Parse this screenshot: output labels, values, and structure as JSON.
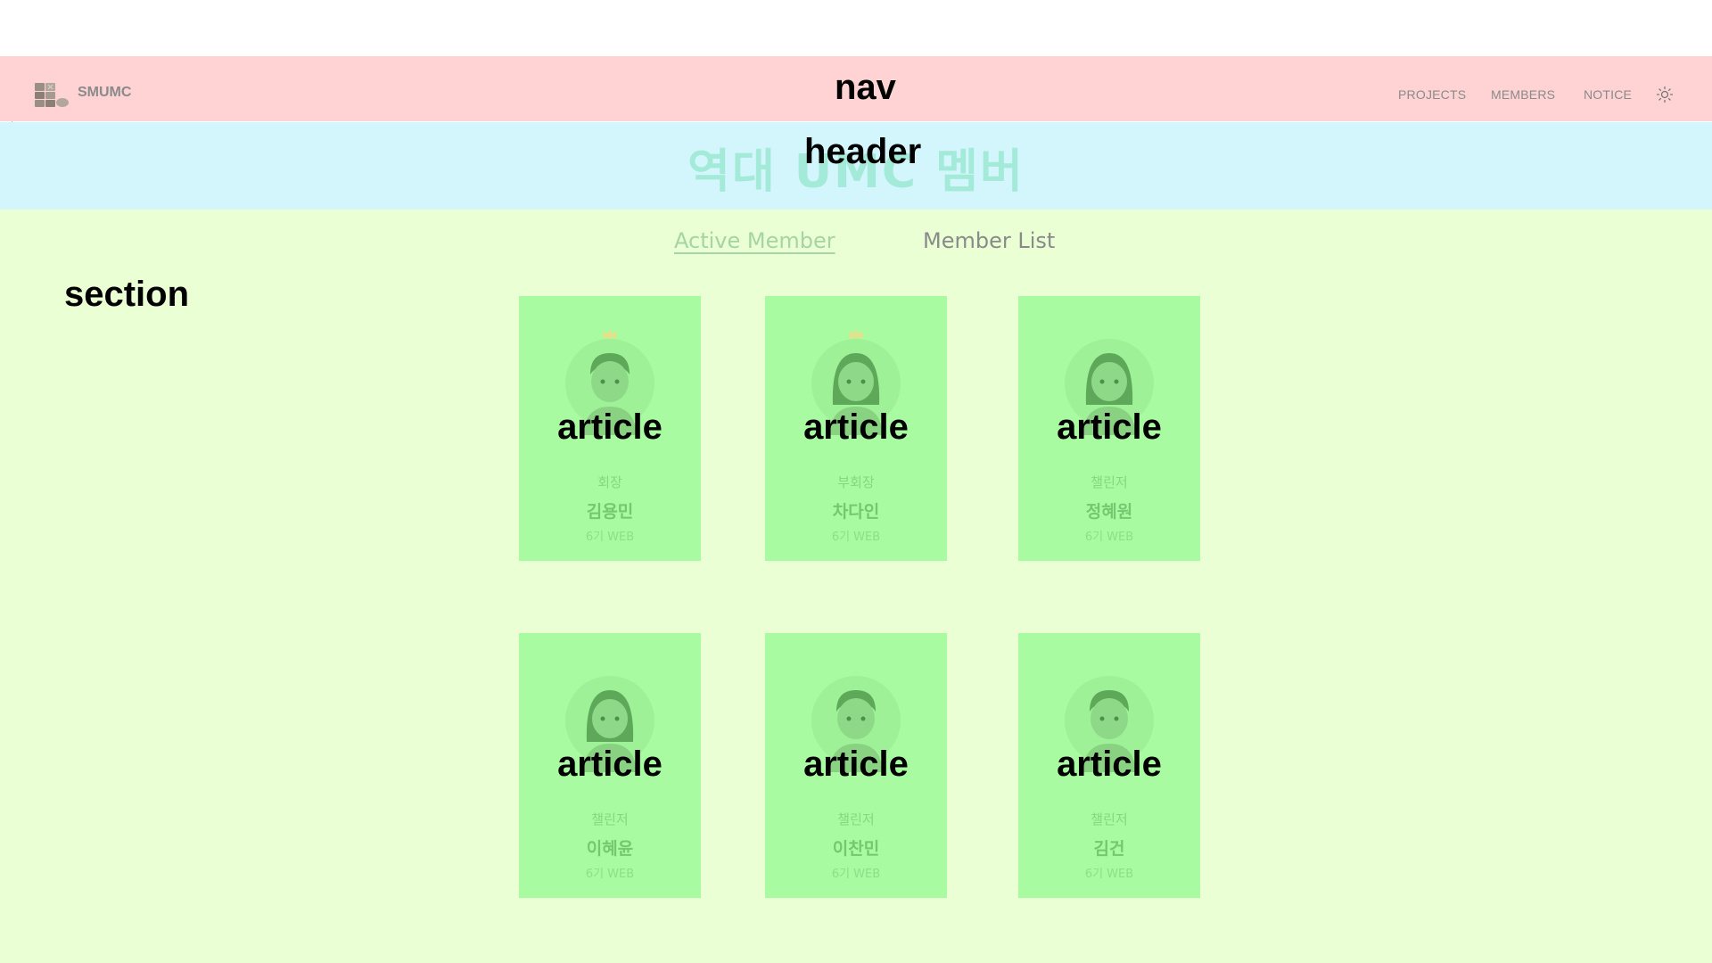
{
  "overlay_tags": {
    "nav": "nav",
    "header": "header",
    "section": "section",
    "article": "article"
  },
  "nav": {
    "brand": "SMUMC",
    "links": [
      {
        "label": "PROJECTS"
      },
      {
        "label": "MEMBERS"
      },
      {
        "label": "NOTICE"
      }
    ],
    "theme_icon": "sun-icon"
  },
  "header": {
    "title": "역대 UMC 멤버"
  },
  "section": {
    "tabs": [
      {
        "label": "Active Member",
        "active": true
      },
      {
        "label": "Member List",
        "active": false
      }
    ],
    "members": [
      {
        "role": "회장",
        "name": "김용민",
        "generation": "6기 WEB",
        "crown": true,
        "avatar": "man"
      },
      {
        "role": "부회장",
        "name": "차다인",
        "generation": "6기 WEB",
        "crown": true,
        "avatar": "woman"
      },
      {
        "role": "챌린저",
        "name": "정혜원",
        "generation": "6기 WEB",
        "crown": false,
        "avatar": "woman"
      },
      {
        "role": "챌린저",
        "name": "이혜윤",
        "generation": "6기 WEB",
        "crown": false,
        "avatar": "woman"
      },
      {
        "role": "챌린저",
        "name": "이찬민",
        "generation": "6기 WEB",
        "crown": false,
        "avatar": "man"
      },
      {
        "role": "챌린저",
        "name": "김건",
        "generation": "6기 WEB",
        "crown": false,
        "avatar": "man"
      }
    ]
  },
  "colors": {
    "nav_bg": "#ffd3d3",
    "header_bg": "#d3f6fd",
    "section_bg": "#eaffd3",
    "card_bg": "#a8fba1",
    "title_color": "#a3ead8"
  }
}
